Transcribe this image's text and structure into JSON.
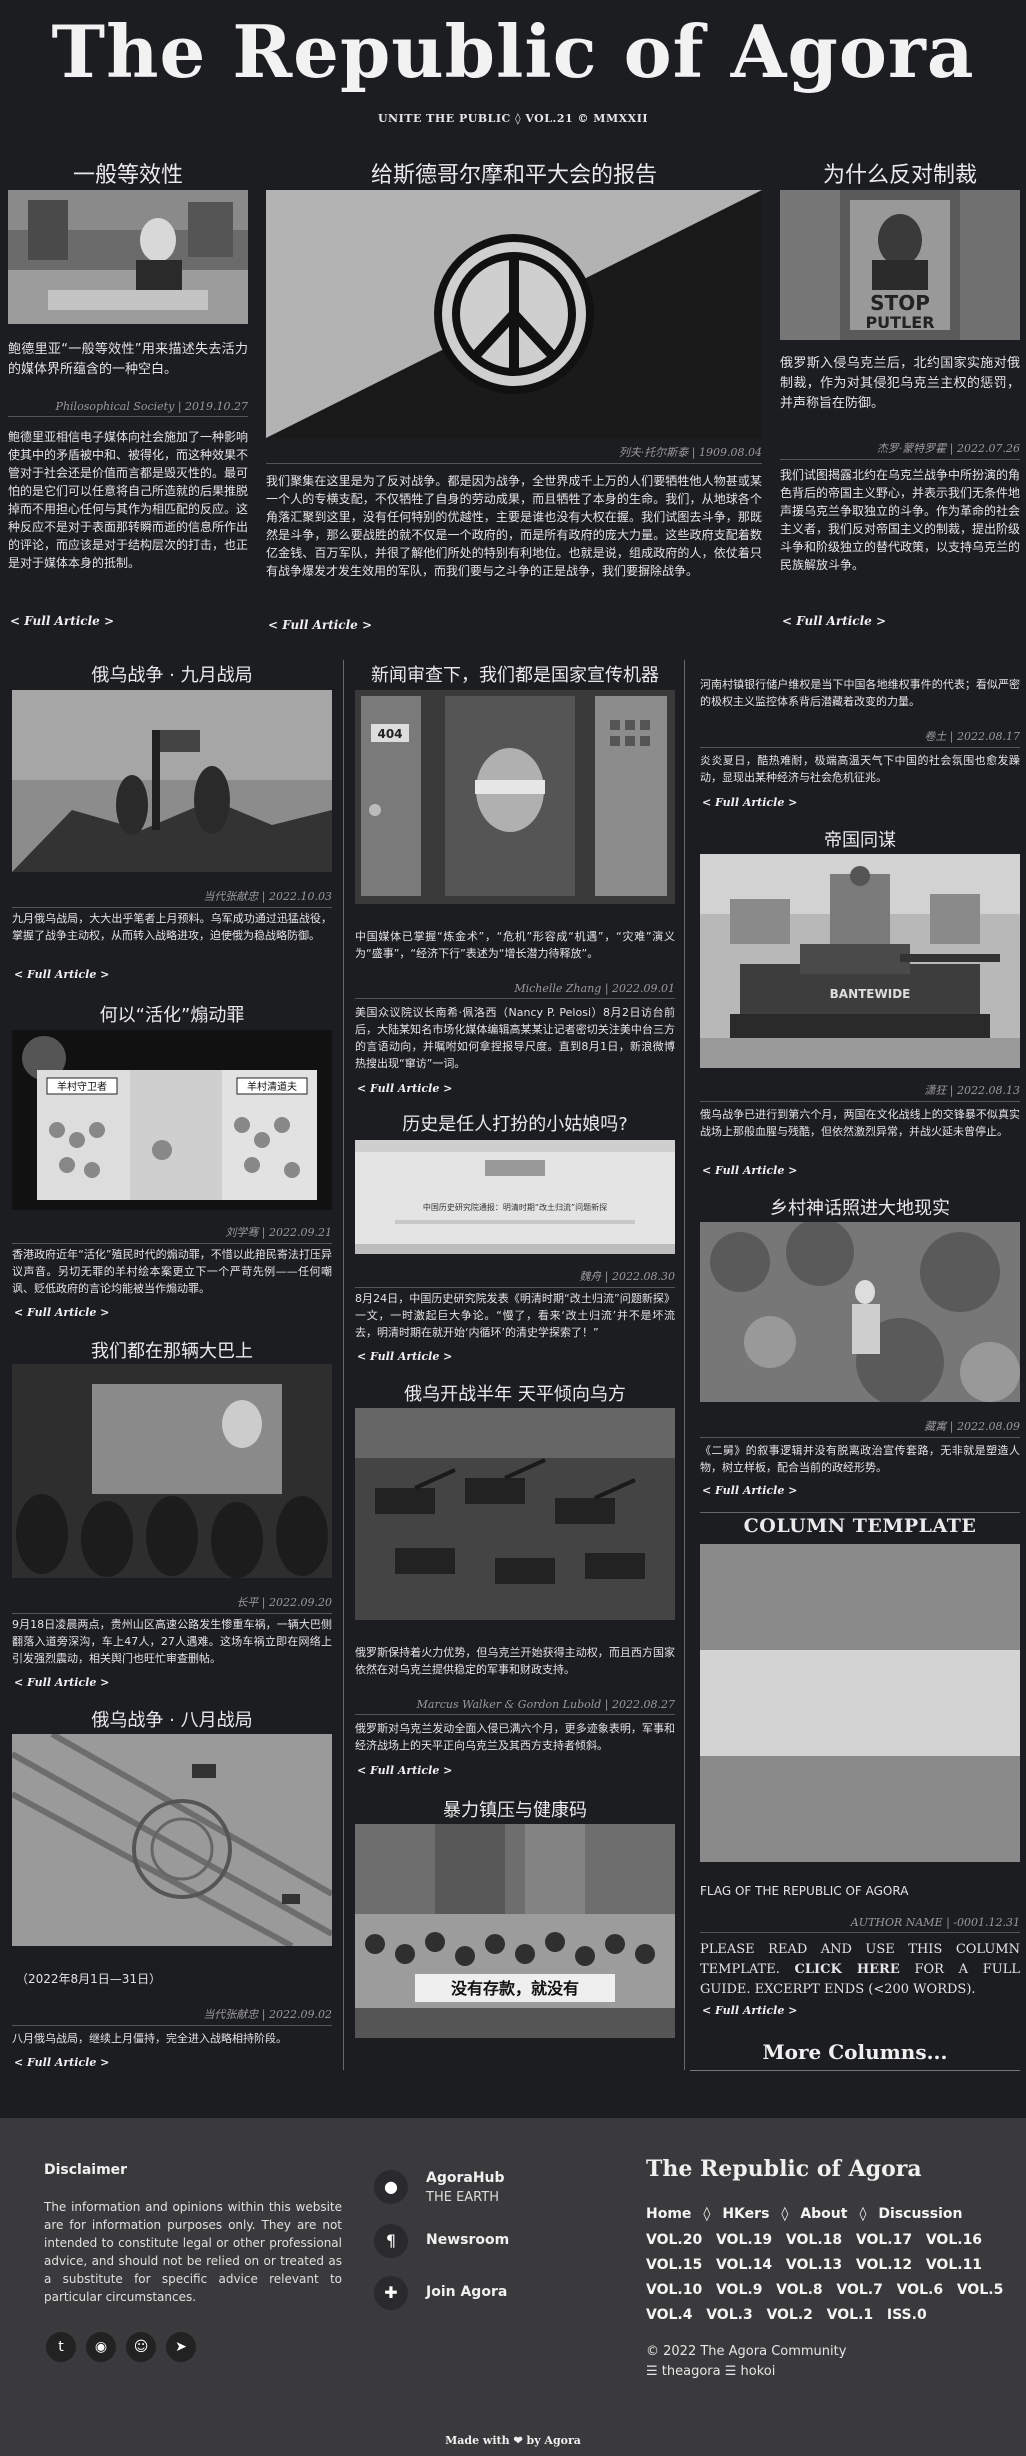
{
  "masthead": {
    "title": "The Republic of Agora",
    "subtitle": "UNITE THE PUBLIC ◊ VOL.21 © MMXXII"
  },
  "top": {
    "left": {
      "title": "一般等效性",
      "lead": "鲍德里亚“一般等效性”用来描述失去活力的媒体界所蕴含的一种空白。",
      "byline": "Philosophical Society | 2019.10.27",
      "body": "鲍德里亚相信电子媒体向社会施加了一种影响使其中的矛盾被中和、被得化，而这种效果不管对于社会还是价值而言都是毁灭性的。最可怕的是它们可以任意将自己所造就的后果推脱掉而不用担心任何与其作为相匹配的反应。这种反应不是对于表面那转瞬而逝的信息所作出的评论，而应该是对于结构层次的打击，也正是对于媒体本身的抵制。",
      "more": "< Full Article >"
    },
    "center": {
      "title": "给斯德哥尔摩和平大会的报告",
      "byline": "列夫·托尔斯泰 | 1909.08.04",
      "body": "我们聚集在这里是为了反对战争。都是因为战争，全世界成千上万的人们要牺牲他人物甚或某一个人的专横支配，不仅牺牲了自身的劳动成果，而且牺牲了本身的生命。我们，从地球各个角落汇聚到这里，没有任何特别的优越性，主要是谁也没有大权在握。我们试图去斗争，那既然是斗争，那么要战胜的就不仅是一个政府的，而是所有政府的庞大力量。这些政府支配着数亿金钱、百万军队，并很了解他们所处的特别有利地位。也就是说，组成政府的人，依仗着只有战争爆发才发生效用的军队，而我们要与之斗争的正是战争，我们要摒除战争。",
      "more": "< Full Article >"
    },
    "right": {
      "title": "为什么反对制裁",
      "image_text": "STOP PUTLER",
      "lead": "俄罗斯入侵乌克兰后，北约国家实施对俄制裁，作为对其侵犯乌克兰主权的惩罚，并声称旨在防御。",
      "byline": "杰罗·蒙特罗霍 | 2022.07.26",
      "body": "我们试图揭露北约在乌克兰战争中所扮演的角色背后的帝国主义野心，并表示我们无条件地声援乌克兰争取独立的斗争。作为革命的社会主义者，我们反对帝国主义的制裁，提出阶级斗争和阶级独立的替代政策，以支持乌克兰的民族解放斗争。",
      "more": "< Full Article >"
    }
  },
  "col1": [
    {
      "title": "俄乌战争 · 九月战局",
      "byline": "当代张献忠 | 2022.10.03",
      "body": "九月俄乌战局，大大出乎笔者上月预料。乌军成功通过迅猛战役，掌握了战争主动权，从而转入战略进攻，迫使俄为稳战略防御。",
      "more": "< Full Article >"
    },
    {
      "title": "何以“活化”煽动罪",
      "image_labels": [
        "羊村守卫者",
        "羊村清道夫"
      ],
      "byline": "刘学骞 | 2022.09.21",
      "body": "香港政府近年“活化”殖民时代的煽动罪，不惜以此箝民寄法打压异议声音。另切无罪的羊村绘本案更立下一个严苛先例——任何嘲讽、贬低政府的言论均能被当作煽动罪。",
      "more": "< Full Article >"
    },
    {
      "title": "我们都在那辆大巴上",
      "byline": "长平 | 2022.09.20",
      "body": "9月18日凌晨两点，贵州山区高速公路发生惨重车祸，一辆大巴侧翻落入道旁深沟，车上47人，27人遇难。这场车祸立即在网络上引发强烈震动，相关舆门也旺忙审查删帖。",
      "more": "< Full Article >"
    },
    {
      "title": "俄乌战争 · 八月战局",
      "caption": "（2022年8月1日—31日）",
      "byline": "当代张献忠 | 2022.09.02",
      "body": "八月俄乌战局，继续上月僵持，完全进入战略相持阶段。",
      "more": "< Full Article >"
    }
  ],
  "col2": [
    {
      "title": "新闻审查下，我们都是国家宣传机器",
      "image_text": "404",
      "lead": "中国媒体已掌握“炼金术”，“危机”形容成“机遇”，“灾难”演义为“盛事”，“经济下行”表述为“增长潜力待释放”。",
      "byline": "Michelle Zhang | 2022.09.01",
      "body": "美国众议院议长南希·佩洛西（Nancy P. Pelosi）8月2日访台前后，大陆某知名市场化媒体编辑高某某让记者密切关注美中台三方的言语动向，并嘱咐如何拿捏报导尺度。直到8月1日，新浪微博热搜出现“窜访”一词。",
      "more": "< Full Article >"
    },
    {
      "title": "历史是任人打扮的小姑娘吗?",
      "image_text": "中国历史研究院通报：明清时期“改土归流”问题新探",
      "byline": "魏舟 | 2022.08.30",
      "body": "8月24日，中国历史研究院发表《明清时期“改土归流”问题新探》一文，一时激起巨大争论。“慢了，看来‘改土归流’并不是坏流去，明清时期在就开始‘内循环’的清史学探索了！”",
      "more": "< Full Article >"
    },
    {
      "title": "俄乌开战半年 天平倾向乌方",
      "lead": "俄罗斯保持着火力优势，但乌克兰开始获得主动权，而且西方国家依然在对乌克兰提供稳定的军事和财政支持。",
      "byline": "Marcus Walker & Gordon Lubold | 2022.08.27",
      "body": "俄罗斯对乌克兰发动全面入侵已满六个月，更多迹象表明，军事和经济战场上的天平正向乌克兰及其西方支持者倾斜。",
      "more": "< Full Article >"
    },
    {
      "title": "暴力镇压与健康码",
      "image_text": "没有存款，就没有"
    }
  ],
  "col3": {
    "top_item": {
      "body": "河南村镇银行储户维权是当下中国各地维权事件的代表；看似严密的极权主义监控体系背后潜藏着改变的力量。",
      "byline": "卷土 | 2022.08.17",
      "body2": "炎炎夏日，酷热难耐，极端高温天气下中国的社会氛围也愈发躁动，显现出某种经济与社会危机征兆。",
      "more": "< Full Article >"
    },
    "items": [
      {
        "title": "帝国同谋",
        "image_text": "BANTEWIDE",
        "byline": "潇狂 | 2022.08.13",
        "body": "俄乌战争已进行到第六个月，两国在文化战线上的交锋暴不似真实战场上那般血腥与残酷，但依然激烈异常，并战火延未曾停止。",
        "more": "< Full Article >"
      },
      {
        "title": "乡村神话照进大地现实",
        "byline": "藏寓 | 2022.08.09",
        "body": "《二舅》的叙事逻辑并没有脱离政治宣传套路，无非就是塑造人物，树立样板，配合当前的政经形势。",
        "more": "< Full Article >"
      }
    ],
    "template": {
      "title": "COLUMN TEMPLATE",
      "caption": "FLAG OF THE REPUBLIC OF AGORA",
      "byline": "AUTHOR NAME | -0001.12.31",
      "body_pre": "PLEASE READ AND USE THIS COLUMN TEMPLATE. ",
      "body_link": "CLICK HERE",
      "body_post": " FOR A FULL GUIDE. EXCERPT ENDS (<200 WORDS).",
      "more": "< Full Article >"
    },
    "more_columns": "More Columns..."
  },
  "footer": {
    "disclaimer_title": "Disclaimer",
    "disclaimer": "The information and opinions within this website are for information purposes only. They are not intended to constitute legal or other professional advice, and should not be relied on or treated as a substitute for specific advice relevant to particular circumstances.",
    "social": [
      "twitter-icon",
      "github-icon",
      "reddit-icon",
      "telegram-icon"
    ],
    "links": [
      {
        "title": "AgoraHub",
        "sub": "THE EARTH"
      },
      {
        "title": "Newsroom",
        "sub": ""
      },
      {
        "title": "Join Agora",
        "sub": ""
      }
    ],
    "brand": "The Republic of Agora",
    "nav": [
      "Home",
      "◊",
      "HKers",
      "◊",
      "About",
      "◊",
      "Discussion"
    ],
    "vols_rows": [
      "VOL.20  VOL.19  VOL.18  VOL.17  VOL.16",
      "VOL.15  VOL.14  VOL.13  VOL.12  VOL.11",
      "VOL.10  VOL.9  VOL.8  VOL.7  VOL.6  VOL.5",
      "VOL.4  VOL.3  VOL.2  VOL.1  ISS.0"
    ],
    "copyright": "© 2022 The Agora Community",
    "credits": "☰ theagora ☰ hokoi",
    "made_with": "Made with ❤ by Agora"
  }
}
